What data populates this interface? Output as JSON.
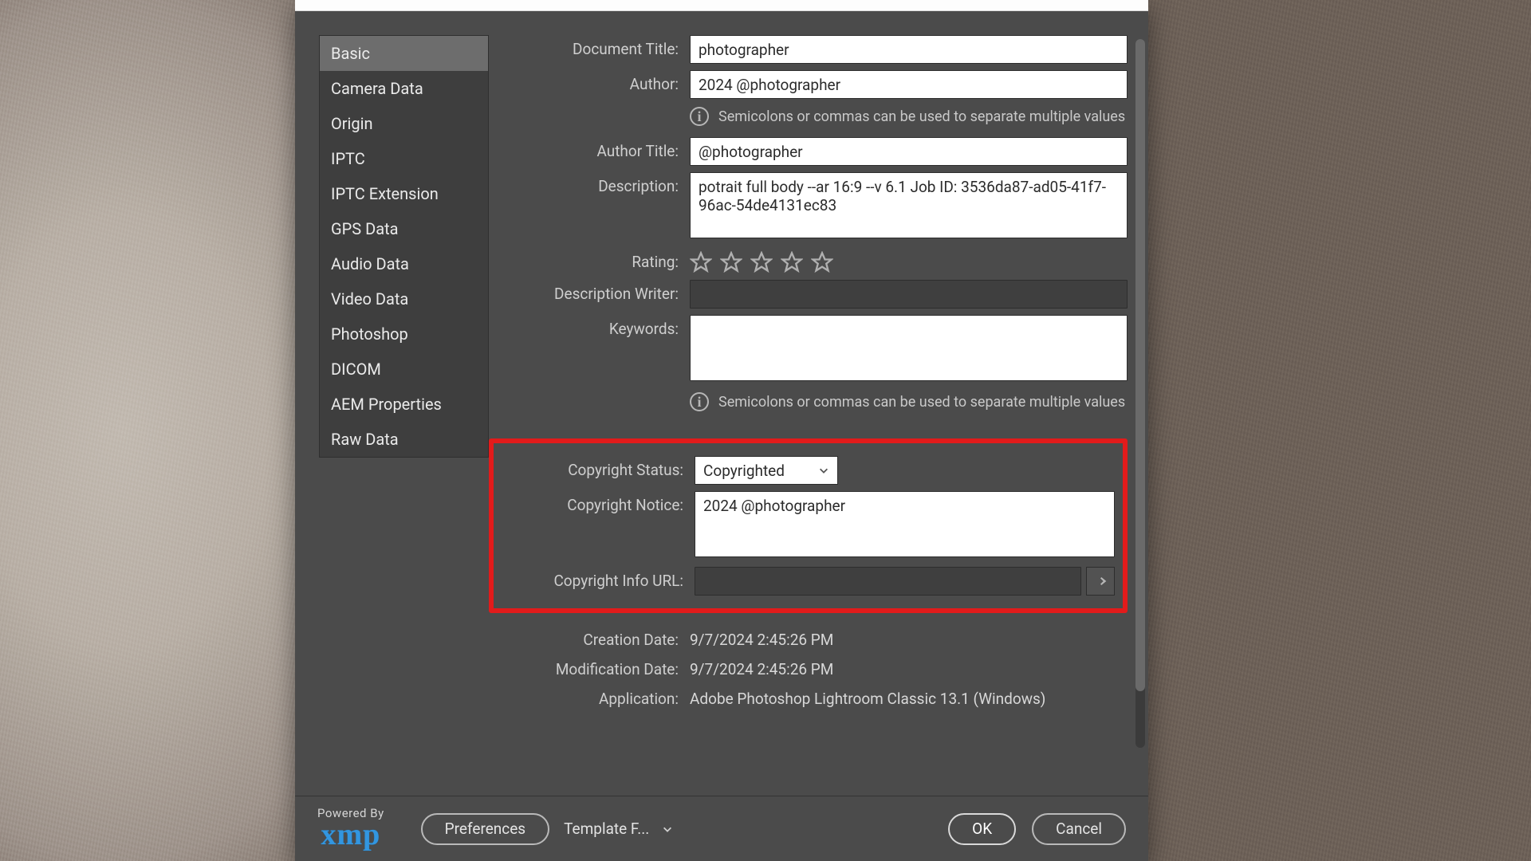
{
  "sidebar": {
    "items": [
      {
        "label": "Basic"
      },
      {
        "label": "Camera Data"
      },
      {
        "label": "Origin"
      },
      {
        "label": "IPTC"
      },
      {
        "label": "IPTC Extension"
      },
      {
        "label": "GPS Data"
      },
      {
        "label": "Audio Data"
      },
      {
        "label": "Video Data"
      },
      {
        "label": "Photoshop"
      },
      {
        "label": "DICOM"
      },
      {
        "label": "AEM Properties"
      },
      {
        "label": "Raw Data"
      }
    ],
    "selected_index": 0
  },
  "labels": {
    "document_title": "Document Title:",
    "author": "Author:",
    "author_title": "Author Title:",
    "description": "Description:",
    "rating": "Rating:",
    "description_writer": "Description Writer:",
    "keywords": "Keywords:",
    "copyright_status": "Copyright Status:",
    "copyright_notice": "Copyright Notice:",
    "copyright_info_url": "Copyright Info URL:",
    "creation_date": "Creation Date:",
    "modification_date": "Modification Date:",
    "application": "Application:"
  },
  "values": {
    "document_title": "photographer",
    "author": "2024 @photographer",
    "author_title": "@photographer",
    "description": "potrait full body --ar 16:9 --v 6.1 Job ID: 3536da87-ad05-41f7-96ac-54de4131ec83",
    "rating_stars": 0,
    "description_writer": "",
    "keywords": "",
    "copyright_status": "Copyrighted",
    "copyright_notice": "2024 @photographer",
    "copyright_info_url": "",
    "creation_date": "9/7/2024 2:45:26 PM",
    "modification_date": "9/7/2024 2:45:26 PM",
    "application": "Adobe Photoshop Lightroom Classic 13.1 (Windows)"
  },
  "hint_text": "Semicolons or commas can be used to separate multiple values",
  "footer": {
    "powered_by": "Powered By",
    "brand": "xmp",
    "preferences": "Preferences",
    "template": "Template F...",
    "ok": "OK",
    "cancel": "Cancel"
  }
}
